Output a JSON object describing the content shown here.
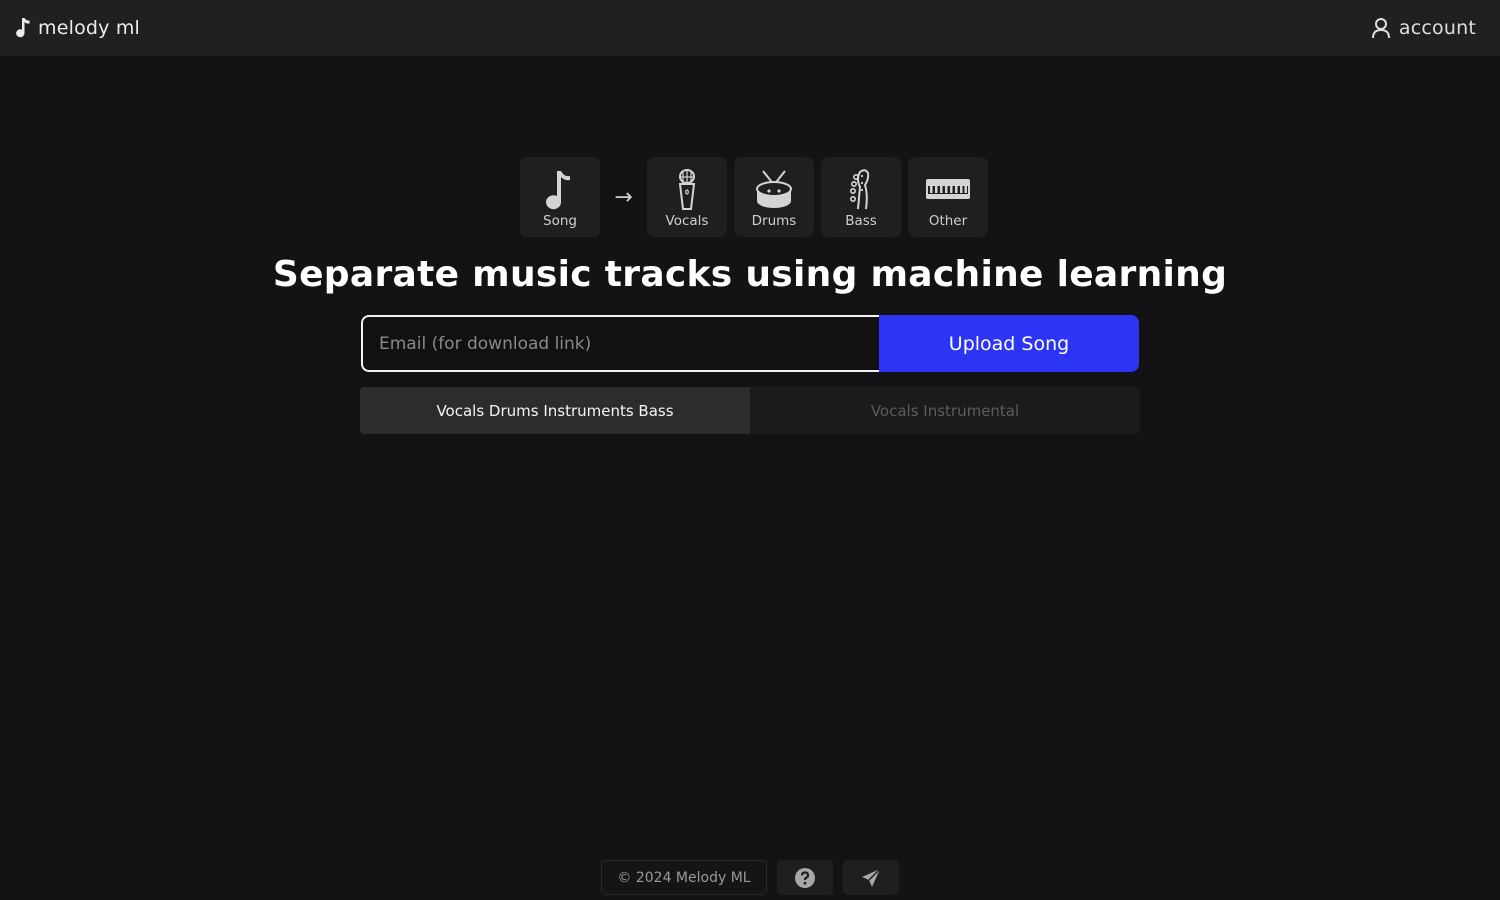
{
  "header": {
    "brand": "melody ml",
    "brand_icon": "music-note-icon",
    "account_label": "account",
    "account_icon": "user-icon"
  },
  "stems": {
    "source": {
      "label": "Song",
      "icon": "music-note-icon"
    },
    "arrow": "→",
    "outputs": [
      {
        "label": "Vocals",
        "icon": "microphone-icon"
      },
      {
        "label": "Drums",
        "icon": "drum-icon"
      },
      {
        "label": "Bass",
        "icon": "bass-guitar-icon"
      },
      {
        "label": "Other",
        "icon": "keyboard-icon"
      }
    ]
  },
  "headline": "Separate music tracks using machine learning",
  "form": {
    "email_value": "",
    "email_placeholder": "Email (for download link)",
    "upload_label": "Upload Song",
    "accent_color": "#2d35f5"
  },
  "separation_options": {
    "selected": "Vocals Drums Instruments Bass",
    "options": [
      "Vocals Drums Instruments Bass",
      "Vocals Instrumental"
    ]
  },
  "footer": {
    "copyright": "© 2024 Melody ML",
    "help_icon": "question-circle-icon",
    "contact_icon": "paper-plane-icon"
  }
}
